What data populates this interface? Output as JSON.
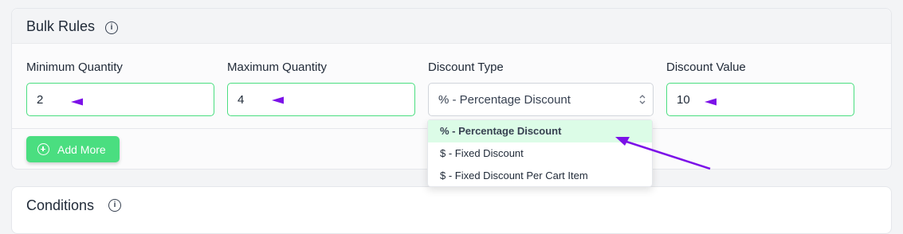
{
  "bulk_rules": {
    "title": "Bulk Rules",
    "info_icon": "info-icon",
    "fields": {
      "min_qty": {
        "label": "Minimum Quantity",
        "value": "2"
      },
      "max_qty": {
        "label": "Maximum Quantity",
        "value": "4"
      },
      "discount_type": {
        "label": "Discount Type",
        "value": "% - Percentage Discount"
      },
      "discount_value": {
        "label": "Discount Value",
        "value": "10"
      }
    },
    "add_more_label": "Add More"
  },
  "dropdown": {
    "options": [
      "% - Percentage Discount",
      "$ - Fixed Discount",
      "$ - Fixed Discount Per Cart Item"
    ],
    "selected_index": 0
  },
  "conditions": {
    "title": "Conditions",
    "info_icon": "info-icon"
  },
  "colors": {
    "accent": "#4ade80",
    "annotation_arrow": "#7c11e8",
    "selected_option_bg": "#dcfce7"
  }
}
